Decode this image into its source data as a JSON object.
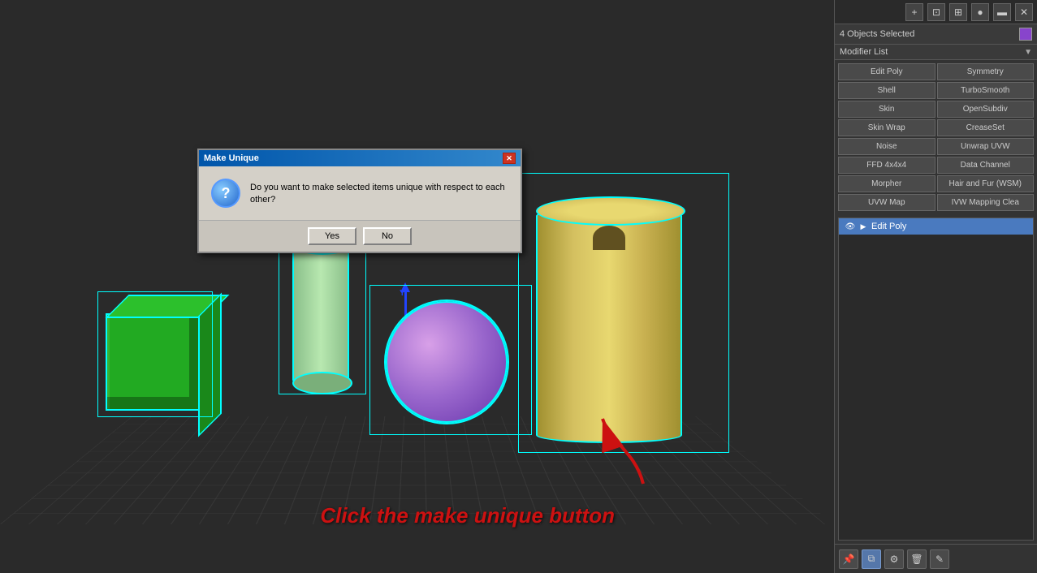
{
  "toolbar": {
    "icons": [
      "⊕",
      "⊡",
      "⊞",
      "●",
      "▬",
      "✕"
    ]
  },
  "right_panel": {
    "selected_bar": {
      "text": "4 Objects Selected",
      "color": "#8844cc"
    },
    "modifier_list": {
      "label": "Modifier List",
      "arrow": "▼"
    },
    "modifier_buttons": [
      {
        "label": "Edit Poly",
        "id": "edit-poly"
      },
      {
        "label": "Symmetry",
        "id": "symmetry"
      },
      {
        "label": "Shell",
        "id": "shell"
      },
      {
        "label": "TurboSmooth",
        "id": "turbosmooth"
      },
      {
        "label": "Skin",
        "id": "skin"
      },
      {
        "label": "OpenSubdiv",
        "id": "opensubdiv"
      },
      {
        "label": "Skin Wrap",
        "id": "skin-wrap"
      },
      {
        "label": "CreaseSet",
        "id": "creaseset"
      },
      {
        "label": "Noise",
        "id": "noise"
      },
      {
        "label": "Unwrap UVW",
        "id": "unwrap-uvw"
      },
      {
        "label": "FFD 4x4x4",
        "id": "ffd-4x4x4"
      },
      {
        "label": "Data Channel",
        "id": "data-channel"
      },
      {
        "label": "Morpher",
        "id": "morpher"
      },
      {
        "label": "Hair and Fur (WSM)",
        "id": "hair-fur"
      },
      {
        "label": "UVW Map",
        "id": "uvw-map"
      },
      {
        "label": "IVW Mapping Clea",
        "id": "ivw-map"
      }
    ],
    "stack": {
      "active_item": "Edit Poly"
    },
    "bottom_icons": [
      "🔑",
      "▦",
      "⚙",
      "🗑",
      "✎"
    ]
  },
  "dialog": {
    "title": "Make Unique",
    "close_label": "✕",
    "icon_label": "?",
    "message": "Do you want to make selected items unique with respect to each other?",
    "yes_label": "Yes",
    "no_label": "No"
  },
  "annotation": {
    "text": "Click the make unique button"
  }
}
